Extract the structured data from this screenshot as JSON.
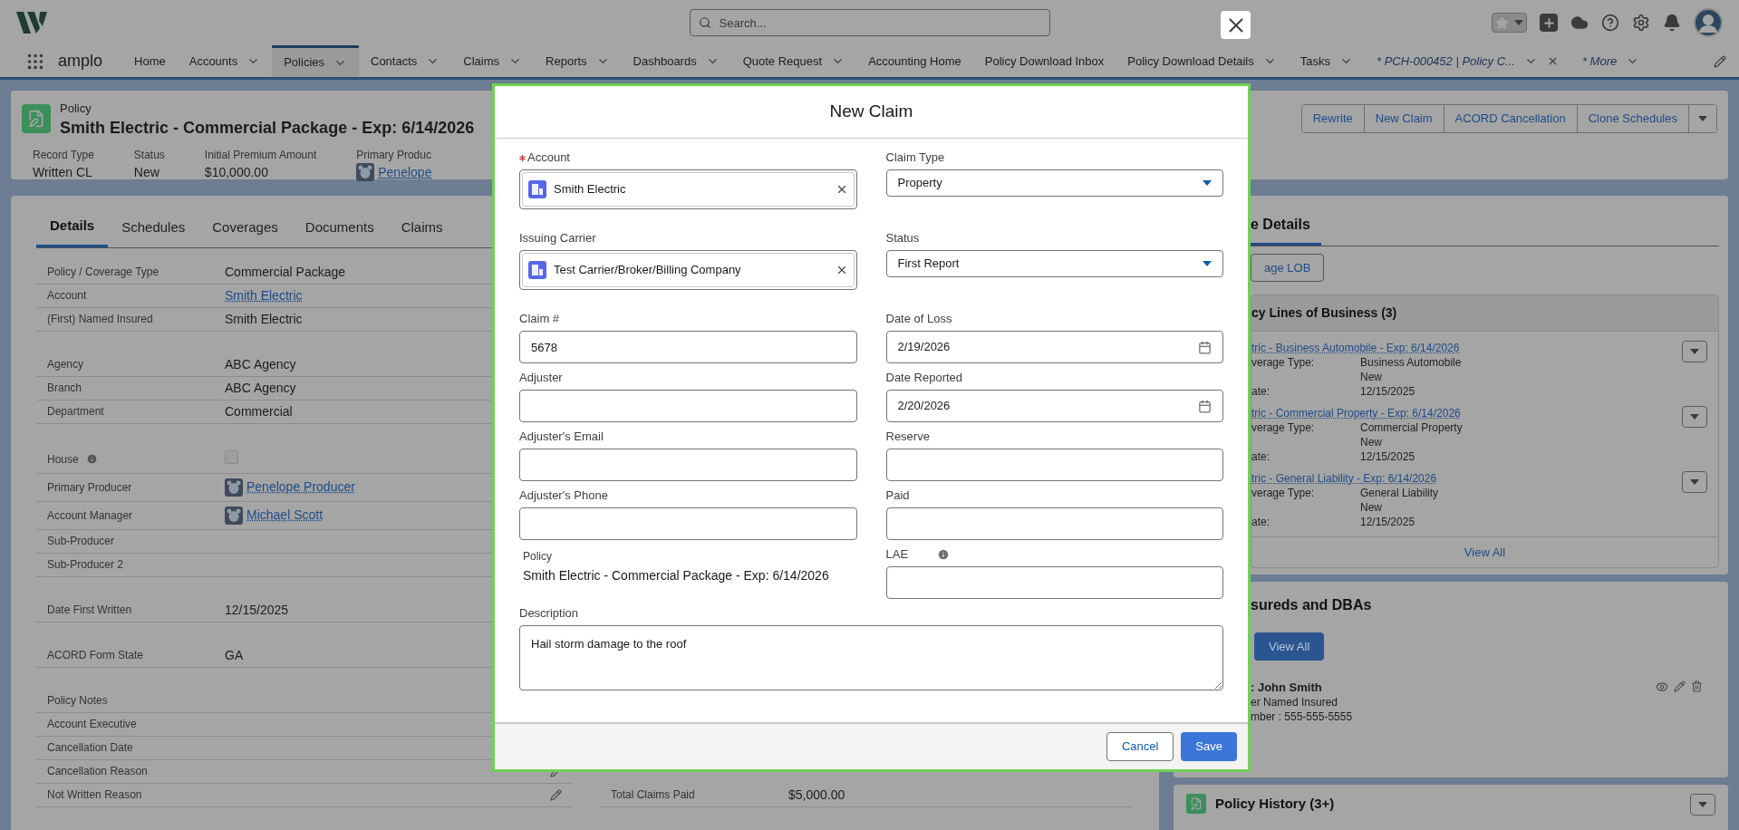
{
  "top_bar": {
    "search": {
      "placeholder": "Search..."
    }
  },
  "nav": {
    "app_name": "amplo",
    "tabs": [
      {
        "label": "Home",
        "selected": false,
        "menu": false,
        "kind": "object"
      },
      {
        "label": "Accounts",
        "selected": false,
        "menu": true,
        "kind": "object"
      },
      {
        "label": "Policies",
        "selected": true,
        "menu": true,
        "kind": "object"
      },
      {
        "label": "Contacts",
        "selected": false,
        "menu": true,
        "kind": "object"
      },
      {
        "label": "Claims",
        "selected": false,
        "menu": true,
        "kind": "object"
      },
      {
        "label": "Reports",
        "selected": false,
        "menu": true,
        "kind": "object"
      },
      {
        "label": "Dashboards",
        "selected": false,
        "menu": true,
        "kind": "object"
      },
      {
        "label": "Quote Request",
        "selected": false,
        "menu": true,
        "kind": "object"
      },
      {
        "label": "Accounting Home",
        "selected": false,
        "menu": false,
        "kind": "object"
      },
      {
        "label": "Policy Download Inbox",
        "selected": false,
        "menu": false,
        "kind": "object"
      },
      {
        "label": "Policy Download Details",
        "selected": false,
        "menu": true,
        "kind": "object"
      },
      {
        "label": "Tasks",
        "selected": false,
        "menu": true,
        "kind": "object"
      },
      {
        "label": "* PCH-000452 | Policy C...",
        "selected": false,
        "menu": true,
        "closable": true,
        "kind": "workspace"
      },
      {
        "label": "* More",
        "selected": false,
        "menu": true,
        "kind": "workspace"
      }
    ]
  },
  "record": {
    "object_type": "Policy",
    "title": "Smith Electric - Commercial Package - Exp: 6/14/2026",
    "highlights": [
      {
        "label": "Record Type",
        "value": "Written CL",
        "kind": "text"
      },
      {
        "label": "Status",
        "value": "New",
        "kind": "text"
      },
      {
        "label": "Initial Premium Amount",
        "value": "$10,000.00",
        "kind": "text"
      },
      {
        "label": "Primary Produc",
        "value": "Penelope",
        "kind": "user"
      }
    ],
    "actions": [
      "Rewrite",
      "New Claim",
      "ACORD Cancellation",
      "Clone Schedules"
    ]
  },
  "details": {
    "tabs": [
      {
        "label": "Details",
        "selected": true
      },
      {
        "label": "Schedules",
        "selected": false
      },
      {
        "label": "Coverages",
        "selected": false
      },
      {
        "label": "Documents",
        "selected": false
      },
      {
        "label": "Claims",
        "selected": false
      }
    ],
    "sections": [
      [
        {
          "label": "Policy / Coverage Type",
          "value": "Commercial Package",
          "kind": "text"
        },
        {
          "label": "Account",
          "value": "Smith Electric",
          "kind": "link"
        },
        {
          "label": "(First) Named Insured",
          "value": "Smith Electric",
          "kind": "text"
        }
      ],
      [
        {
          "label": "Agency",
          "value": "ABC Agency",
          "kind": "text"
        },
        {
          "label": "Branch",
          "value": "ABC Agency",
          "kind": "text"
        },
        {
          "label": "Department",
          "value": "Commercial",
          "kind": "text"
        }
      ],
      [
        {
          "label": "House",
          "kind": "checkbox",
          "checked": false,
          "info": true
        },
        {
          "label": "Primary Producer",
          "value": "Penelope Producer",
          "kind": "user"
        },
        {
          "label": "Account Manager",
          "value": "Michael Scott",
          "kind": "user"
        },
        {
          "label": "Sub-Producer",
          "kind": "text"
        },
        {
          "label": "Sub-Producer 2",
          "kind": "text"
        }
      ],
      [
        {
          "label": "Date First Written",
          "value": "12/15/2025",
          "kind": "text"
        }
      ],
      [
        {
          "label": "ACORD Form State",
          "value": "GA",
          "kind": "text"
        }
      ],
      [
        {
          "label": "Policy Notes",
          "kind": "text"
        },
        {
          "label": "Account Executive",
          "kind": "text"
        },
        {
          "label": "Cancellation Date",
          "kind": "text"
        },
        {
          "label": "Cancellation Reason",
          "kind": "text",
          "editable": true
        },
        {
          "label": "Not Written Reason",
          "kind": "text",
          "editable": true
        }
      ]
    ],
    "right_rows": [
      {
        "label": "Total Claims Paid",
        "value": "$5,000.00",
        "kind": "text"
      }
    ]
  },
  "side": {
    "tab": "e Details",
    "action": "age LOB",
    "lines_card": {
      "title": "cy Lines of Business (3)",
      "items": [
        {
          "title": "tric - Business Automobile - Exp: 6/14/2026",
          "fields": [
            {
              "label": "verage Type:",
              "value": "Business Automobile"
            },
            {
              "value": "New"
            },
            {
              "label": "ate:",
              "value": "12/15/2025"
            }
          ]
        },
        {
          "title": "tric - Commercial Property - Exp: 6/14/2026",
          "fields": [
            {
              "label": "verage Type:",
              "value": "Commercial Property"
            },
            {
              "value": "New"
            },
            {
              "label": "ate:",
              "value": "12/15/2025"
            }
          ]
        },
        {
          "title": "tric - General Liability - Exp: 6/14/2026",
          "fields": [
            {
              "label": "verage Type:",
              "value": "General Liability"
            },
            {
              "value": "New"
            },
            {
              "label": "ate:",
              "value": "12/15/2025"
            }
          ]
        }
      ],
      "view_all": "View All"
    },
    "insureds_card": {
      "title": "sureds and DBAs",
      "button": "View All",
      "entry": {
        "name": ": John Smith",
        "lines": [
          "er Named Insured",
          "mber : 555-555-5555"
        ]
      }
    },
    "history_card": {
      "title": "Policy History (3+)"
    }
  },
  "modal": {
    "title": "New Claim",
    "rows": [
      [
        {
          "label": "Account",
          "kind": "lookup",
          "value": "Smith Electric",
          "required": true
        },
        {
          "label": "Claim Type",
          "kind": "select",
          "value": "Property"
        }
      ],
      [
        {
          "label": "Issuing Carrier",
          "kind": "lookup",
          "value": "Test Carrier/Broker/Billing Company"
        },
        {
          "label": "Status",
          "kind": "select",
          "value": "First Report"
        }
      ],
      [
        {
          "label": "Claim #",
          "kind": "text",
          "value": "5678"
        },
        {
          "label": "Date of Loss",
          "kind": "date",
          "value": "2/19/2026"
        }
      ],
      [
        {
          "label": "Adjuster",
          "kind": "text"
        },
        {
          "label": "Date Reported",
          "kind": "date",
          "value": "2/20/2026"
        }
      ],
      [
        {
          "label": "Adjuster's Email",
          "kind": "text"
        },
        {
          "label": "Reserve",
          "kind": "text"
        }
      ],
      [
        {
          "label": "Adjuster's Phone",
          "kind": "text"
        },
        {
          "label": "Paid",
          "kind": "text"
        }
      ],
      [
        {
          "label": "Policy",
          "kind": "readonly",
          "value": "Smith Electric - Commercial Package - Exp: 6/14/2026"
        },
        {
          "label": "LAE",
          "kind": "text",
          "info": true
        }
      ]
    ],
    "description": {
      "label": "Description",
      "kind": "textarea",
      "value": "Hail storm damage to the roof"
    },
    "buttons": [
      {
        "label": "Cancel",
        "kind": "neutral"
      },
      {
        "label": "Save",
        "kind": "brand"
      }
    ]
  }
}
